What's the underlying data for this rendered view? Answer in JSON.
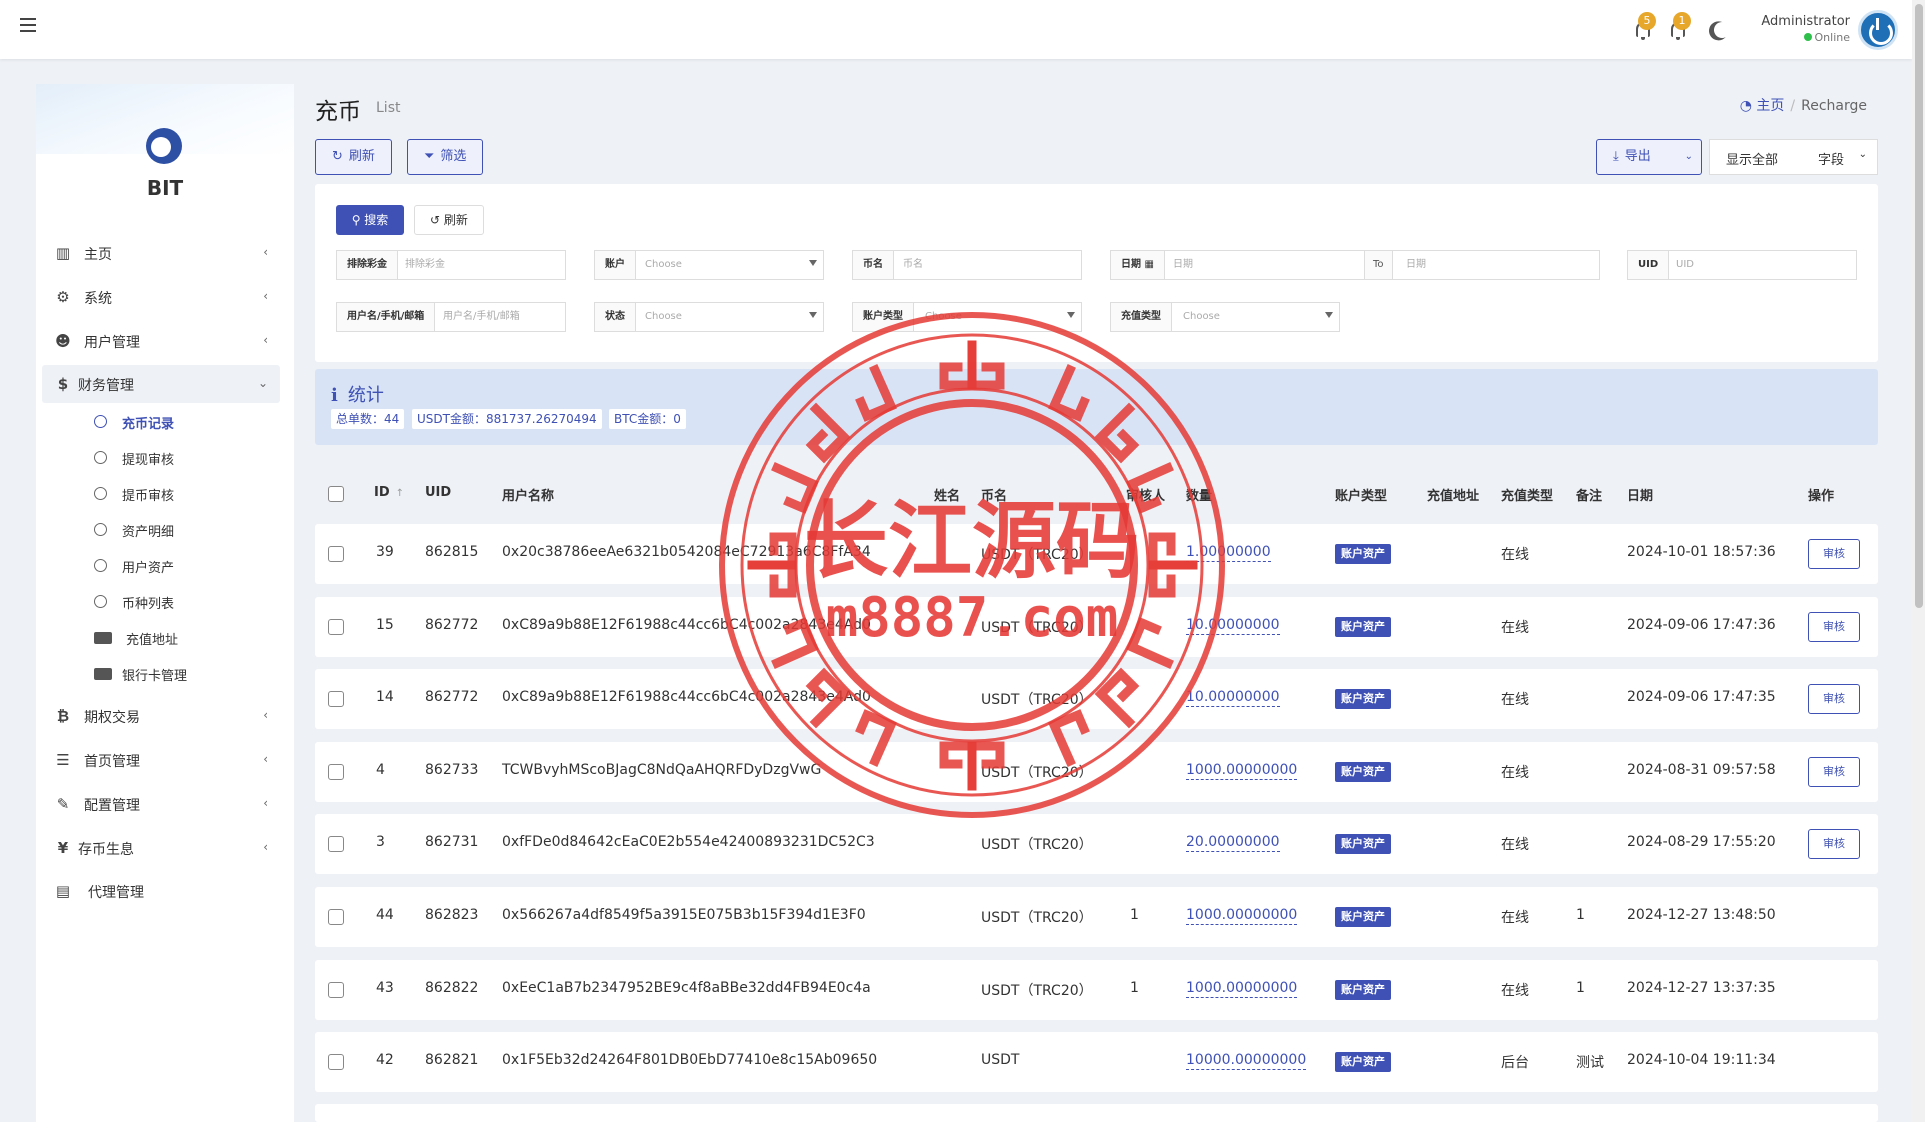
{
  "topbar": {
    "notif_count_1": "5",
    "notif_count_2": "1",
    "admin_name": "Administrator",
    "admin_status": "Online"
  },
  "sidebar": {
    "brand": "BIT",
    "items": [
      {
        "label": "主页",
        "icon": "chart-icon"
      },
      {
        "label": "系统",
        "icon": "gear-icon"
      },
      {
        "label": "用户管理",
        "icon": "users-icon"
      },
      {
        "label": "财务管理",
        "icon": "dollar-icon"
      },
      {
        "label": "期权交易",
        "icon": "bitcoin-icon"
      },
      {
        "label": "首页管理",
        "icon": "list-icon"
      },
      {
        "label": "配置管理",
        "icon": "wrench-icon"
      },
      {
        "label": "存币生息",
        "icon": "yen-icon"
      },
      {
        "label": "代理管理",
        "icon": "idcard-icon"
      }
    ],
    "finance_sub": [
      {
        "label": "充币记录"
      },
      {
        "label": "提现审核"
      },
      {
        "label": "提币审核"
      },
      {
        "label": "资产明细"
      },
      {
        "label": "用户资产"
      },
      {
        "label": "币种列表"
      },
      {
        "label": "充值地址"
      },
      {
        "label": "银行卡管理"
      }
    ]
  },
  "header": {
    "title": "充币",
    "subtitle": "List",
    "breadcrumb_home": "主页",
    "breadcrumb_current": "Recharge",
    "refresh_label": "刷新",
    "filter_label": "筛选",
    "export_label": "导出",
    "show_all_label": "显示全部",
    "fields_label": "字段"
  },
  "filters": {
    "search_label": "搜索",
    "reset_label": "刷新",
    "exclude_label": "排除彩金",
    "exclude_placeholder": "排除彩金",
    "account_label": "账户",
    "account_placeholder": "Choose",
    "coin_label": "币名",
    "coin_placeholder": "币名",
    "date_label": "日期",
    "date_placeholder": "日期",
    "date_to": "To",
    "date_placeholder2": "日期",
    "uid_label": "UID",
    "uid_placeholder": "UID",
    "user_label": "用户名/手机/邮箱",
    "user_placeholder": "用户名/手机/邮箱",
    "status_label": "状态",
    "status_placeholder": "Choose",
    "acct_type_label": "账户类型",
    "acct_type_placeholder": "Choose",
    "recharge_type_label": "充值类型",
    "recharge_type_placeholder": "Choose"
  },
  "stats": {
    "title": "统计",
    "total_orders": "总单数：44",
    "usdt_amount": "USDT金额：881737.26270494",
    "btc_amount": "BTC金额：0"
  },
  "table": {
    "headers": {
      "id": "ID",
      "uid": "UID",
      "username": "用户名称",
      "name": "姓名",
      "coin": "币名",
      "auditor": "审核人",
      "amount": "数量",
      "acct_type": "账户类型",
      "address": "充值地址",
      "rtype": "充值类型",
      "remark": "备注",
      "date": "日期",
      "action": "操作"
    },
    "rows": [
      {
        "id": "39",
        "uid": "862815",
        "username": "0x20c38786eeAe6321b0542084eC72913a6C8FfA34",
        "coin": "USDT（TRC20）",
        "auditor": "",
        "amount": "1.00000000",
        "acct_type": "账户资产",
        "rtype": "在线",
        "remark": "",
        "date": "2024-10-01 18:57:36",
        "action": "审核"
      },
      {
        "id": "15",
        "uid": "862772",
        "username": "0xC89a9b88E12F61988c44cc6bC4c002a2843e4Ad0",
        "coin": "USDT（TRC20）",
        "auditor": "",
        "amount": "10.00000000",
        "acct_type": "账户资产",
        "rtype": "在线",
        "remark": "",
        "date": "2024-09-06 17:47:36",
        "action": "审核"
      },
      {
        "id": "14",
        "uid": "862772",
        "username": "0xC89a9b88E12F61988c44cc6bC4c002a2843e4Ad0",
        "coin": "USDT（TRC20）",
        "auditor": "",
        "amount": "10.00000000",
        "acct_type": "账户资产",
        "rtype": "在线",
        "remark": "",
        "date": "2024-09-06 17:47:35",
        "action": "审核"
      },
      {
        "id": "4",
        "uid": "862733",
        "username": "TCWBvyhMScoBJagC8NdQaAHQRFDyDzgVwG",
        "coin": "USDT（TRC20）",
        "auditor": "",
        "amount": "1000.00000000",
        "acct_type": "账户资产",
        "rtype": "在线",
        "remark": "",
        "date": "2024-08-31 09:57:58",
        "action": "审核"
      },
      {
        "id": "3",
        "uid": "862731",
        "username": "0xfFDe0d84642cEaC0E2b554e42400893231DC52C3",
        "coin": "USDT（TRC20）",
        "auditor": "",
        "amount": "20.00000000",
        "acct_type": "账户资产",
        "rtype": "在线",
        "remark": "",
        "date": "2024-08-29 17:55:20",
        "action": "审核"
      },
      {
        "id": "44",
        "uid": "862823",
        "username": "0x566267a4df8549f5a3915E075B3b15F394d1E3F0",
        "coin": "USDT（TRC20）",
        "auditor": "1",
        "amount": "1000.00000000",
        "acct_type": "账户资产",
        "rtype": "在线",
        "remark": "1",
        "date": "2024-12-27 13:48:50",
        "action": ""
      },
      {
        "id": "43",
        "uid": "862822",
        "username": "0xEeC1aB7b2347952BE9c4f8aBBe32dd4FB94E0c4a",
        "coin": "USDT（TRC20）",
        "auditor": "1",
        "amount": "1000.00000000",
        "acct_type": "账户资产",
        "rtype": "在线",
        "remark": "1",
        "date": "2024-12-27 13:37:35",
        "action": ""
      },
      {
        "id": "42",
        "uid": "862821",
        "username": "0x1F5Eb32d24264F801DB0EbD77410e8c15Ab09650",
        "coin": "USDT",
        "auditor": "",
        "amount": "10000.00000000",
        "acct_type": "账户资产",
        "rtype": "后台",
        "remark": "测试",
        "date": "2024-10-04 19:11:34",
        "action": ""
      }
    ]
  },
  "watermark": {
    "line1": "长江源码",
    "line2": "m8887.com",
    "color": "#e53935"
  },
  "colors": {
    "accent": "#3f51b5",
    "badge": "#e6a72a",
    "stats_bg": "#d8e4f6"
  }
}
